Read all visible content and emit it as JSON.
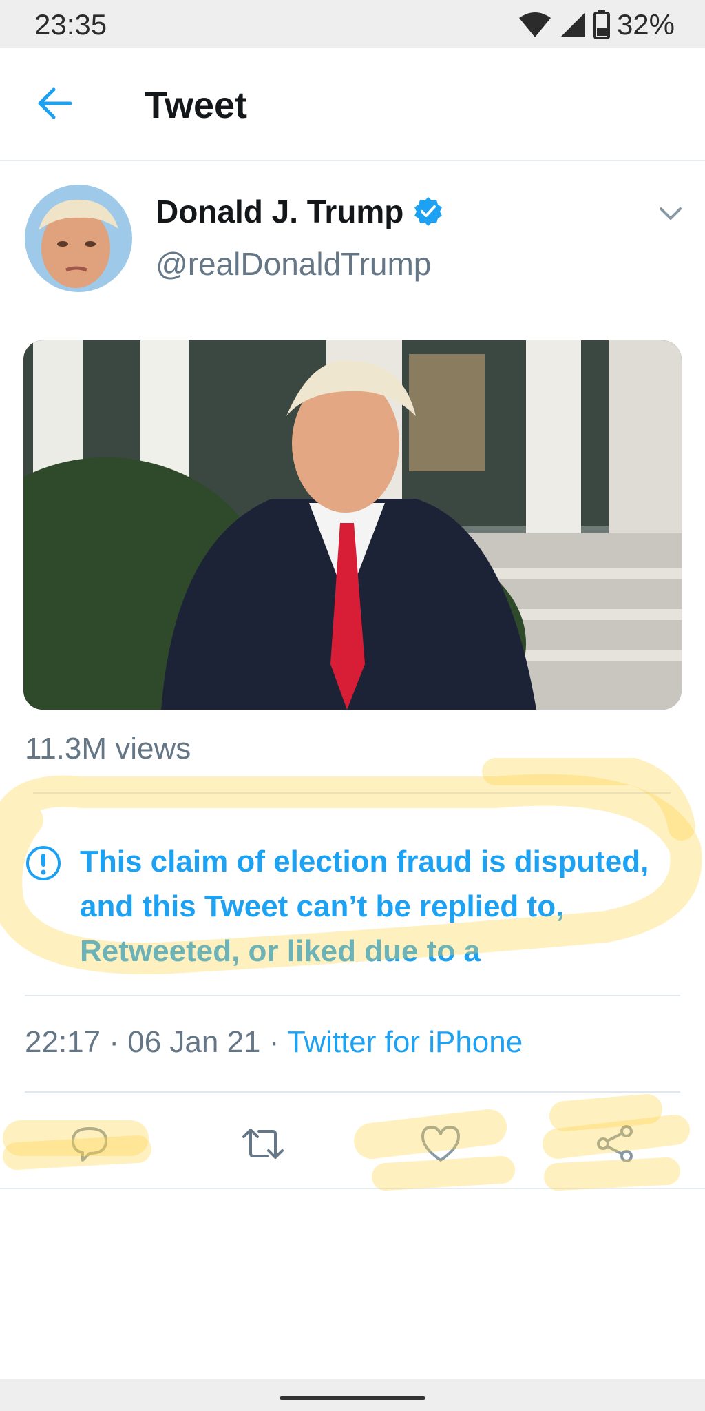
{
  "status_bar": {
    "time": "23:35",
    "battery": "32%"
  },
  "header": {
    "title": "Tweet"
  },
  "tweet": {
    "author_name": "Donald J. Trump",
    "handle": "@realDonaldTrump",
    "views": "11.3M views",
    "notice": "This claim of election fraud is disputed, and this Tweet can’t be replied to, Retweeted, or liked due to a",
    "time": "22:17",
    "date": "06 Jan 21",
    "source": "Twitter for iPhone",
    "separator": "·"
  },
  "icons": {
    "back": "arrow-left-icon",
    "verified": "verified-badge-icon",
    "caret": "chevron-down-icon",
    "notice": "exclamation-circle-icon",
    "reply": "reply-icon",
    "retweet": "retweet-icon",
    "like": "heart-icon",
    "share": "share-icon"
  },
  "colors": {
    "accent": "#1da1f2",
    "secondary_text": "#657786",
    "highlight": "#ffd54a"
  }
}
